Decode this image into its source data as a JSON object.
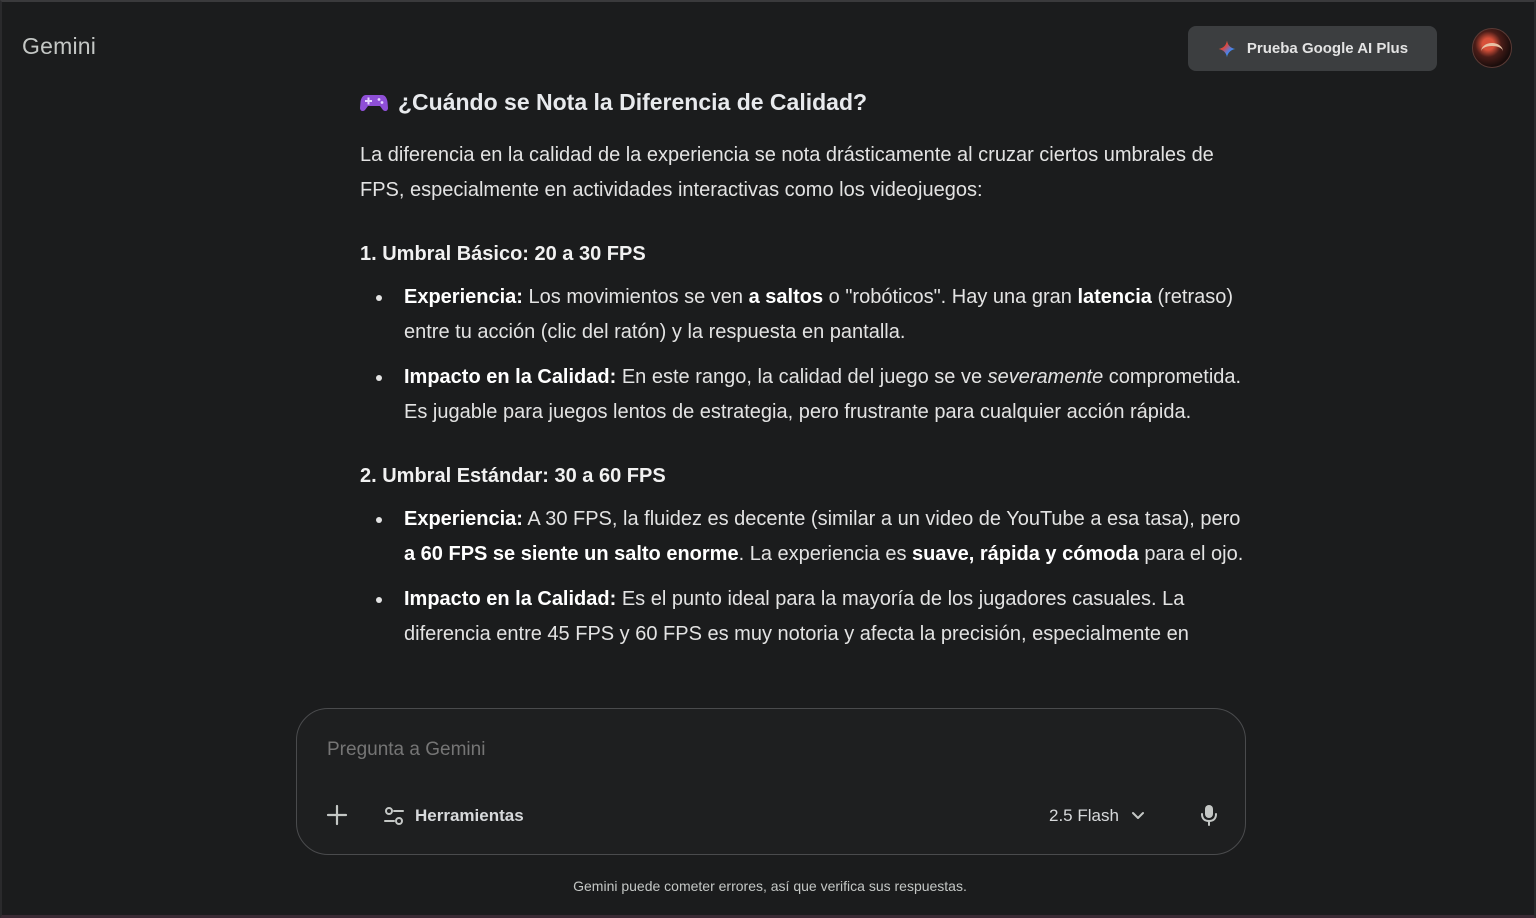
{
  "header": {
    "brand": "Gemini",
    "upgrade_label": "Prueba Google AI Plus"
  },
  "content": {
    "heading": "¿Cuándo se Nota la Diferencia de Calidad?",
    "intro": "La diferencia en la calidad de la experiencia se nota drásticamente al cruzar ciertos umbrales de FPS, especialmente en actividades interactivas como los videojuegos:",
    "section1": {
      "title": "1. Umbral Básico: 20 a 30 FPS",
      "b1": {
        "label": "Experiencia:",
        "t1": " Los movimientos se ven ",
        "bold1": "a saltos",
        "t2": " o \"robóticos\". Hay una gran ",
        "bold2": "latencia",
        "t3": " (retraso) entre tu acción (clic del ratón) y la respuesta en pantalla."
      },
      "b2": {
        "label": "Impacto en la Calidad:",
        "t1": " En este rango, la calidad del juego se ve ",
        "italic": "severamente",
        "t2": " comprometida. Es jugable para juegos lentos de estrategia, pero frustrante para cualquier acción rápida."
      }
    },
    "section2": {
      "title": "2. Umbral Estándar: 30 a 60 FPS",
      "b1": {
        "label": "Experiencia:",
        "t1": " A 30 FPS, la fluidez es decente (similar a un video de YouTube a esa tasa), pero ",
        "bold1": "a 60 FPS se siente un salto enorme",
        "t2": ". La experiencia es ",
        "bold2": "suave, rápida y cómoda",
        "t3": " para el ojo."
      },
      "b2": {
        "label": "Impacto en la Calidad:",
        "t1": " Es el punto ideal para la mayoría de los jugadores casuales. La diferencia entre 45 FPS y 60 FPS es muy notoria y afecta la precisión, especialmente en"
      }
    }
  },
  "composer": {
    "placeholder": "Pregunta a Gemini",
    "tools_label": "Herramientas",
    "model_label": "2.5 Flash"
  },
  "footer": {
    "disclaimer": "Gemini puede cometer errores, así que verifica sus respuestas."
  }
}
